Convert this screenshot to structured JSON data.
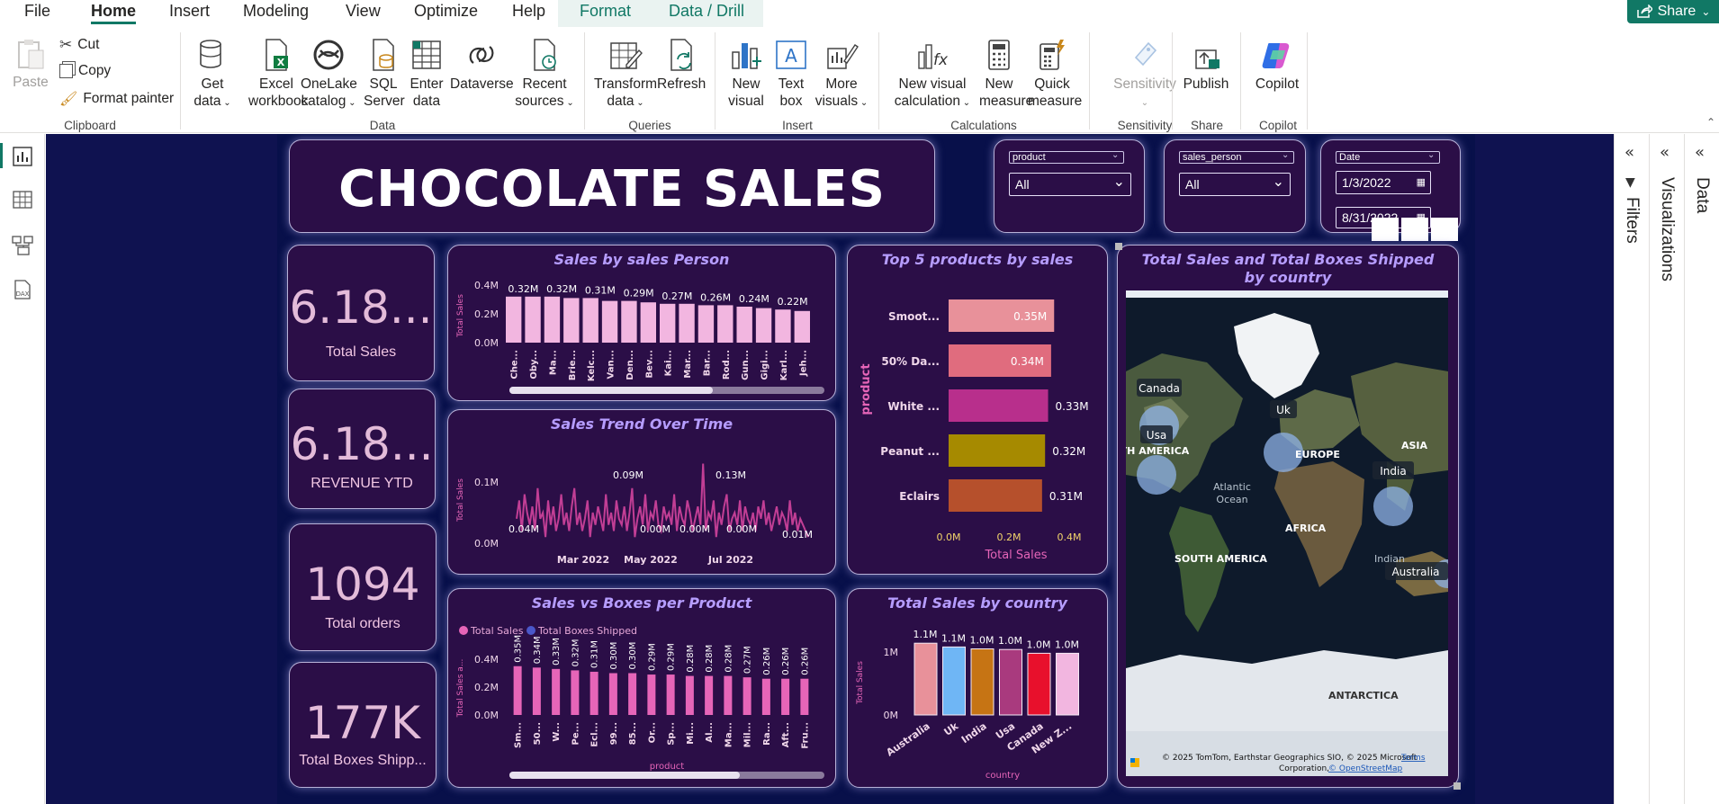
{
  "menu": {
    "file": "File",
    "home": "Home",
    "insert": "Insert",
    "modeling": "Modeling",
    "view": "View",
    "optimize": "Optimize",
    "help": "Help",
    "format": "Format",
    "data_drill": "Data / Drill",
    "share": "Share"
  },
  "ribbon": {
    "paste": "Paste",
    "cut": "Cut",
    "copy": "Copy",
    "format_painter": "Format painter",
    "get_data": [
      "Get",
      "data"
    ],
    "excel": [
      "Excel",
      "workbook"
    ],
    "onelake": [
      "OneLake",
      "catalog"
    ],
    "sql": [
      "SQL",
      "Server"
    ],
    "enter": [
      "Enter",
      "data"
    ],
    "dataverse": "Dataverse",
    "recent": [
      "Recent",
      "sources"
    ],
    "transform": [
      "Transform",
      "data"
    ],
    "refresh": "Refresh",
    "new_visual": [
      "New",
      "visual"
    ],
    "text_box": [
      "Text",
      "box"
    ],
    "more_visuals": [
      "More",
      "visuals"
    ],
    "new_visual_calc": [
      "New visual",
      "calculation"
    ],
    "new_measure": [
      "New",
      "measure"
    ],
    "quick_measure": [
      "Quick",
      "measure"
    ],
    "sensitivity": "Sensitivity",
    "publish": "Publish",
    "copilot": "Copilot",
    "groups": {
      "clipboard": "Clipboard",
      "data": "Data",
      "queries": "Queries",
      "insert": "Insert",
      "calculations": "Calculations",
      "sensitivity": "Sensitivity",
      "share": "Share",
      "copilot": "Copilot"
    }
  },
  "panes": {
    "filters": "Filters",
    "visualizations": "Visualizations",
    "data": "Data"
  },
  "report": {
    "title": "CHOCOLATE SALES",
    "slicers": {
      "product_label": "product",
      "product_value": "All",
      "sales_person_label": "sales_person",
      "sales_person_value": "All",
      "date_label": "Date",
      "date_start": "1/3/2022",
      "date_end": "8/31/2022"
    },
    "kpis": [
      {
        "value": "6.18...",
        "label": "Total Sales"
      },
      {
        "value": "6.18...",
        "label": "REVENUE YTD"
      },
      {
        "value": "1094",
        "label": "Total orders"
      },
      {
        "value": "177K",
        "label": "Total Boxes Shipp..."
      }
    ],
    "map": {
      "title": "Total Sales and Total Boxes Shipped by country",
      "labels": {
        "canada": "Canada",
        "uk": "Uk",
        "usa": "Usa",
        "india": "India",
        "australia": "Australia",
        "europe": "EUROPE",
        "asia": "ASIA",
        "n_america": "RTH AMERICA",
        "atlantic": "Atlantic",
        "ocean": "Ocean",
        "africa": "AFRICA",
        "s_america": "SOUTH AMERICA",
        "indian": "Indian",
        "antarctica": "ANTARCTICA"
      },
      "copyright": "© 2025 TomTom, Earthstar Geographics SIO, © 2025 Microsoft",
      "copyright2": "Corporation,",
      "terms": "Terms",
      "osm": "© OpenStreetMap"
    }
  },
  "chart_data": [
    {
      "id": "sales_person",
      "type": "bar",
      "title": "Sales by sales Person",
      "ylabel": "Total Sales",
      "ylim": [
        0,
        0.4
      ],
      "yticks": [
        "0.0M",
        "0.2M",
        "0.4M"
      ],
      "categories": [
        "Che...",
        "Oby...",
        "Ma...",
        "Brie...",
        "Kelc...",
        "Van...",
        "Den...",
        "Bev...",
        "Kai...",
        "Mar...",
        "Bar...",
        "Rod...",
        "Gun...",
        "Gigi...",
        "Karl...",
        "Jeh..."
      ],
      "values": [
        0.32,
        0.32,
        0.32,
        0.31,
        0.31,
        0.29,
        0.29,
        0.28,
        0.27,
        0.27,
        0.26,
        0.26,
        0.25,
        0.24,
        0.23,
        0.22
      ],
      "data_labels": [
        "0.32M",
        "",
        "0.32M",
        "",
        "0.31M",
        "",
        "0.29M",
        "",
        "0.27M",
        "",
        "0.26M",
        "",
        "0.24M",
        "",
        "0.22M",
        ""
      ],
      "color": "#f2b6e0"
    },
    {
      "id": "trend",
      "type": "line",
      "title": "Sales Trend Over Time",
      "ylabel": "Total Sales",
      "yticks": [
        "0.0M",
        "0.1M"
      ],
      "ylim": [
        0,
        0.15
      ],
      "xticks": [
        "Mar 2022",
        "May 2022",
        "Jul 2022"
      ],
      "annotations": [
        "0.04M",
        "0.09M",
        "0.00M",
        "0.00M",
        "0.13M",
        "0.00M",
        "0.01M"
      ],
      "values": [
        0.04,
        0.07,
        0.02,
        0.08,
        0.05,
        0.03,
        0.06,
        0.02,
        0.09,
        0.04,
        0.05,
        0.01,
        0.07,
        0.03,
        0.06,
        0.02,
        0.04,
        0.08,
        0.03,
        0.05,
        0.02,
        0.06,
        0.09,
        0.03,
        0.05,
        0.02,
        0.04,
        0.07,
        0.01,
        0.05,
        0.03,
        0.06,
        0.04,
        0.02,
        0.08,
        0.03,
        0.05,
        0.02,
        0.07,
        0.04,
        0.03,
        0.06,
        0.02,
        0.05,
        0.09,
        0.01,
        0.04,
        0.06,
        0.03,
        0.08,
        0.02,
        0.05,
        0.04,
        0.07,
        0.03,
        0.02,
        0.06,
        0.04,
        0.05,
        0.03,
        0.08,
        0.02,
        0.06,
        0.04,
        0.03,
        0.07,
        0.05,
        0.02,
        0.04,
        0.06,
        0.03,
        0.13,
        0.02,
        0.05,
        0.04,
        0.07,
        0.01,
        0.05,
        0.03,
        0.06,
        0.08,
        0.02,
        0.04,
        0.05,
        0.03,
        0.07,
        0.02,
        0.06,
        0.04,
        0.03,
        0.05,
        0.02,
        0.06,
        0.04,
        0.07,
        0.03,
        0.05,
        0.02,
        0.04,
        0.06,
        0.03,
        0.05,
        0.04,
        0.02,
        0.07,
        0.03,
        0.05,
        0.02,
        0.04,
        0.03,
        0.02,
        0.01
      ],
      "color": "#c23e95"
    },
    {
      "id": "sales_boxes",
      "type": "bar",
      "title": "Sales vs Boxes per Product",
      "ylabel": "Total Sales a...",
      "xlabel": "product",
      "ylim": [
        0,
        0.4
      ],
      "yticks": [
        "0.0M",
        "0.2M",
        "0.4M"
      ],
      "legend": [
        "Total Sales",
        "Total Boxes Shipped"
      ],
      "legend_colors": [
        "#e665b8",
        "#4a57c9"
      ],
      "categories": [
        "Sm...",
        "50...",
        "W...",
        "Pe...",
        "Ecl...",
        "99...",
        "85...",
        "Or...",
        "Sp...",
        "Mi...",
        "Al...",
        "Ma...",
        "Mil...",
        "Ra...",
        "Aft...",
        "Fru..."
      ],
      "values": [
        0.35,
        0.34,
        0.33,
        0.32,
        0.31,
        0.3,
        0.3,
        0.29,
        0.29,
        0.28,
        0.28,
        0.28,
        0.27,
        0.26,
        0.26,
        0.26
      ],
      "data_labels": [
        "0.35M",
        "0.34M",
        "0.33M",
        "0.32M",
        "0.31M",
        "0.30M",
        "0.30M",
        "0.29M",
        "0.29M",
        "0.28M",
        "0.28M",
        "0.28M",
        "0.27M",
        "0.26M",
        "0.26M",
        "0.26M"
      ],
      "color": "#e665b8"
    },
    {
      "id": "top5",
      "type": "bar",
      "orientation": "horizontal",
      "title": "Top 5 products by sales",
      "xlabel": "Total Sales",
      "ylabel": "product",
      "xlim": [
        0,
        0.4
      ],
      "xticks": [
        "0.0M",
        "0.2M",
        "0.4M"
      ],
      "categories": [
        "Smoot...",
        "50% Da...",
        "White ...",
        "Peanut ...",
        "Eclairs"
      ],
      "values": [
        0.35,
        0.34,
        0.33,
        0.32,
        0.31
      ],
      "data_labels": [
        "0.35M",
        "0.34M",
        "0.33M",
        "0.32M",
        "0.31M"
      ],
      "colors": [
        "#e8919a",
        "#e06c7e",
        "#b82f8c",
        "#a68a00",
        "#b6502c"
      ]
    },
    {
      "id": "country",
      "type": "bar",
      "title": "Total Sales by country",
      "ylabel": "Total Sales",
      "xlabel": "country",
      "ylim": [
        0,
        1.2
      ],
      "yticks": [
        "0M",
        "1M"
      ],
      "categories": [
        "Australia",
        "Uk",
        "India",
        "Usa",
        "Canada",
        "New Z..."
      ],
      "values": [
        1.14,
        1.08,
        1.05,
        1.04,
        0.98,
        0.98
      ],
      "data_labels": [
        "1.1M",
        "1.1M",
        "1.0M",
        "1.0M",
        "1.0M",
        "1.0M"
      ],
      "colors": [
        "#e8919a",
        "#6fb6f5",
        "#c67414",
        "#a93a7e",
        "#e8102c",
        "#f2b6e0"
      ]
    }
  ]
}
